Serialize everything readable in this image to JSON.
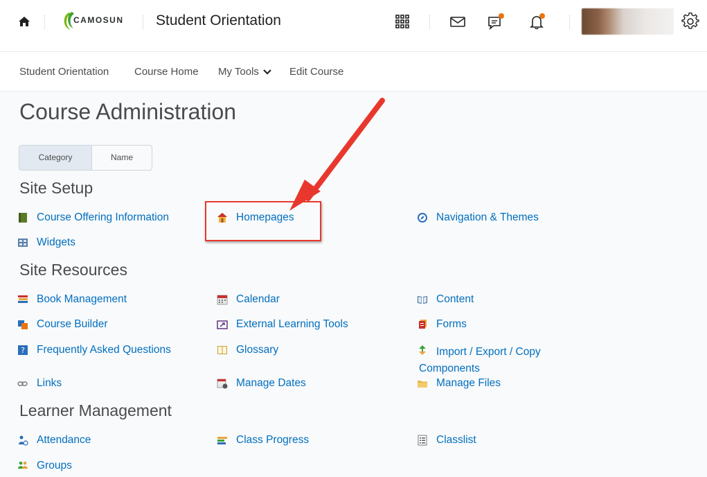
{
  "header": {
    "logo_text": "CAMOSUN",
    "site_title": "Student Orientation",
    "icons": [
      "home-icon",
      "app-grid-icon",
      "mail-icon",
      "chat-icon",
      "bell-icon",
      "settings-icon"
    ],
    "notification_color": "#e87511"
  },
  "nav": {
    "items": [
      "Student Orientation",
      "Course Home",
      "My Tools",
      "Edit Course"
    ]
  },
  "page": {
    "title": "Course Administration",
    "view_toggle": {
      "category": "Category",
      "name": "Name",
      "selected": "Category"
    }
  },
  "sections": [
    {
      "title": "Site Setup",
      "tools": [
        {
          "label": "Course Offering Information",
          "icon": "book-icon"
        },
        {
          "label": "Homepages",
          "icon": "house-icon"
        },
        {
          "label": "Navigation & Themes",
          "icon": "compass-icon"
        },
        {
          "label": "Widgets",
          "icon": "widgets-icon"
        }
      ]
    },
    {
      "title": "Site Resources",
      "tools": [
        {
          "label": "Book Management",
          "icon": "books-icon"
        },
        {
          "label": "Calendar",
          "icon": "calendar-icon"
        },
        {
          "label": "Content",
          "icon": "open-book-icon"
        },
        {
          "label": "Course Builder",
          "icon": "course-builder-icon"
        },
        {
          "label": "External Learning Tools",
          "icon": "external-tool-icon"
        },
        {
          "label": "Forms",
          "icon": "forms-icon"
        },
        {
          "label": "Frequently Asked Questions",
          "icon": "faq-icon"
        },
        {
          "label": "Glossary",
          "icon": "glossary-icon"
        },
        {
          "label": "Import / Export / Copy",
          "label2": "Components",
          "icon": "import-export-icon"
        },
        {
          "label": "Links",
          "icon": "link-icon"
        },
        {
          "label": "Manage Dates",
          "icon": "manage-dates-icon"
        },
        {
          "label": "Manage Files",
          "icon": "folder-icon"
        }
      ]
    },
    {
      "title": "Learner Management",
      "tools": [
        {
          "label": "Attendance",
          "icon": "attendance-icon"
        },
        {
          "label": "Class Progress",
          "icon": "class-progress-icon"
        },
        {
          "label": "Classlist",
          "icon": "classlist-icon"
        },
        {
          "label": "Groups",
          "icon": "groups-icon"
        }
      ]
    }
  ],
  "colors": {
    "link": "#006fbf",
    "annotation": "#e8382e",
    "text": "#494c4e"
  }
}
